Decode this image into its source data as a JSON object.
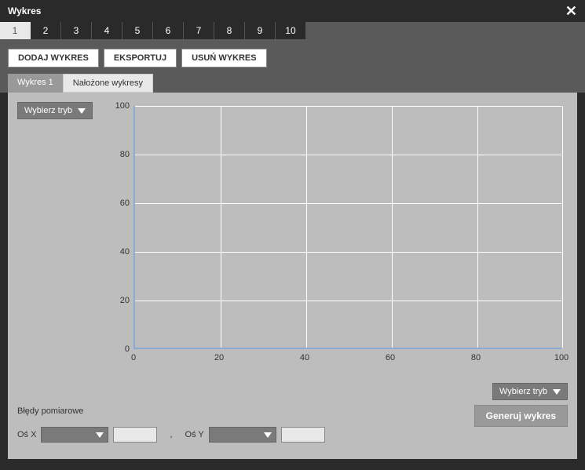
{
  "title": "Wykres",
  "tabs": [
    "1",
    "2",
    "3",
    "4",
    "5",
    "6",
    "7",
    "8",
    "9",
    "10"
  ],
  "active_tab_index": 0,
  "actions": {
    "add": "DODAJ WYKRES",
    "export": "EKSPORTUJ",
    "delete": "USUŃ WYKRES"
  },
  "sub_tabs": {
    "chart1": "Wykres 1",
    "overlay": "Nałożone wykresy"
  },
  "mode_select": "Wybierz tryb",
  "errors_label": "Błędy pomiarowe",
  "generate": "Generuj wykres",
  "axis_x_label": "Oś X",
  "axis_y_label": "Oś Y",
  "axis_x_value": "",
  "axis_y_value": "",
  "chart_data": {
    "type": "line",
    "title": "",
    "xlabel": "",
    "ylabel": "",
    "xlim": [
      0,
      100
    ],
    "ylim": [
      0,
      100
    ],
    "x_ticks": [
      0,
      20,
      40,
      60,
      80,
      100
    ],
    "y_ticks": [
      0,
      20,
      40,
      60,
      80,
      100
    ],
    "series": []
  }
}
